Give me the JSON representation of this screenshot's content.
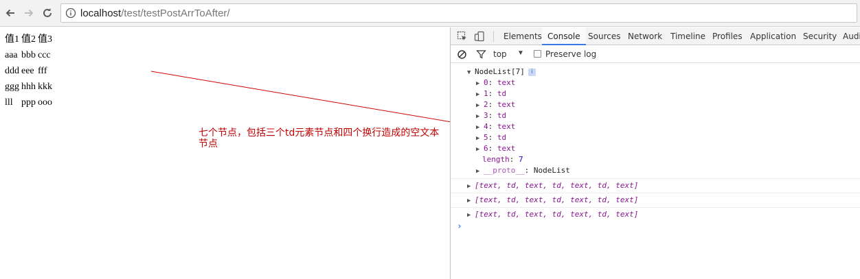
{
  "browser": {
    "url_host": "localhost",
    "url_path": "/test/testPostArrToAfter/"
  },
  "page": {
    "table": [
      [
        "值1",
        "值2",
        "值3"
      ],
      [
        "aaa",
        "bbb",
        "ccc"
      ],
      [
        "ddd",
        "eee",
        "fff"
      ],
      [
        "ggg",
        "hhh",
        "kkk"
      ],
      [
        "lll",
        "ppp",
        "ooo"
      ]
    ],
    "annotation": "七个节点，包括三个td元素节点和四个换行造成的空文本节点",
    "annotation_color": "#c00000"
  },
  "devtools": {
    "tabs": [
      "Elements",
      "Console",
      "Sources",
      "Network",
      "Timeline",
      "Profiles",
      "Application",
      "Security",
      "Audit"
    ],
    "active_tab": "Console",
    "context": "top",
    "preserve_log_label": "Preserve log",
    "preserve_log_checked": false,
    "nodelist_header": "NodeList[7]",
    "nodelist_items": [
      {
        "index": "0",
        "type": "text"
      },
      {
        "index": "1",
        "type": "td"
      },
      {
        "index": "2",
        "type": "text"
      },
      {
        "index": "3",
        "type": "td"
      },
      {
        "index": "4",
        "type": "text"
      },
      {
        "index": "5",
        "type": "td"
      },
      {
        "index": "6",
        "type": "text"
      }
    ],
    "length_key": "length",
    "length_value": "7",
    "proto_key": "__proto__",
    "proto_value": "NodeList",
    "array_messages": [
      "[text, td, text, td, text, td, text]",
      "[text, td, text, td, text, td, text]",
      "[text, td, text, td, text, td, text]"
    ],
    "accent_color": "#3b78e7"
  }
}
